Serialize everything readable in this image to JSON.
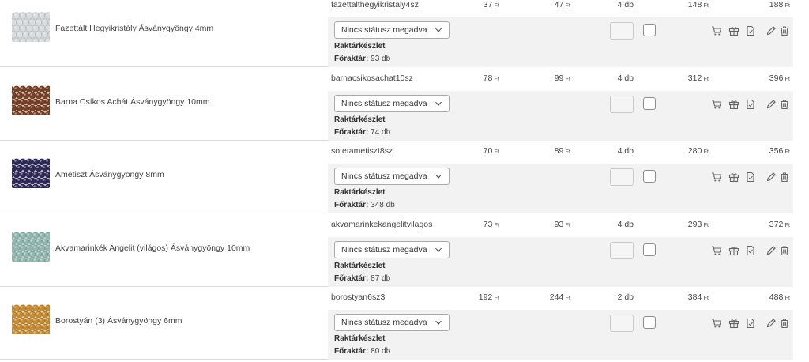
{
  "currency": "Ft",
  "status_placeholder": "Nincs státusz megadva",
  "stock_title": "Raktárkészlet",
  "stock_label": "Főraktár:",
  "products": [
    {
      "name": "Fazettált Hegyikristály Ásványgyöngy 4mm",
      "sku": "fazettalthegyikristaly4sz",
      "price_net": "37",
      "price_gross": "47",
      "qty": "4 db",
      "total_net": "148",
      "total_gross": "188",
      "stock": "93 db",
      "bead_color": "#d9dde0"
    },
    {
      "name": "Barna Csíkos Achát Ásványgyöngy 10mm",
      "sku": "barnacsikosachat10sz",
      "price_net": "78",
      "price_gross": "99",
      "qty": "4 db",
      "total_net": "312",
      "total_gross": "396",
      "stock": "74 db",
      "bead_color": "#7a3f22"
    },
    {
      "name": "Ametiszt Ásványgyöngy 8mm",
      "sku": "sotetametiszt8sz",
      "price_net": "70",
      "price_gross": "89",
      "qty": "4 db",
      "total_net": "280",
      "total_gross": "356",
      "stock": "348 db",
      "bead_color": "#2e2a5a"
    },
    {
      "name": "Akvamarinkék Angelit (világos) Ásványgyöngy 10mm",
      "sku": "akvamarinkekangelitvilagos",
      "price_net": "73",
      "price_gross": "93",
      "qty": "4 db",
      "total_net": "293",
      "total_gross": "372",
      "stock": "87 db",
      "bead_color": "#8fb9b0"
    },
    {
      "name": "Borostyán (3) Ásványgyöngy 6mm",
      "sku": "borostyan6sz3",
      "price_net": "192",
      "price_gross": "244",
      "qty": "2 db",
      "total_net": "384",
      "total_gross": "488",
      "stock": "80 db",
      "bead_color": "#c98a2a"
    }
  ]
}
